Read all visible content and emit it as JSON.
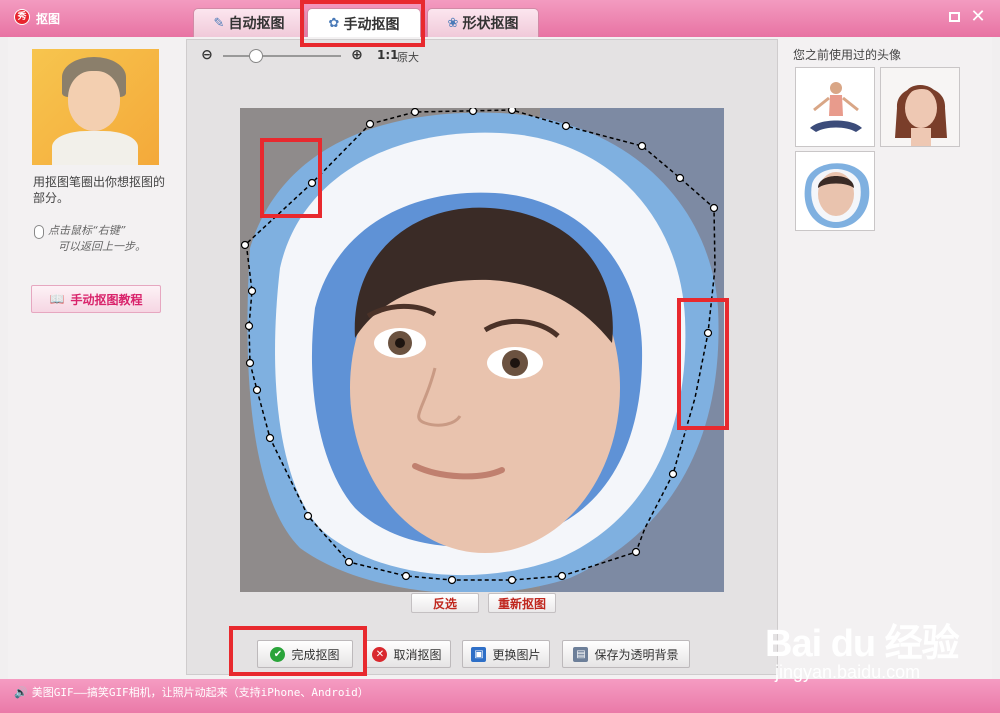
{
  "window": {
    "title": "抠图",
    "app_icon_glyph": "秀"
  },
  "tabs": [
    {
      "label": "自动抠图",
      "icon": "brush-icon",
      "active": false
    },
    {
      "label": "手动抠图",
      "icon": "pen-icon",
      "active": true
    },
    {
      "label": "形状抠图",
      "icon": "shape-icon",
      "active": false
    }
  ],
  "left": {
    "hint": "用抠图笔圈出你想抠图的部分。",
    "mouse_hint_line1": "点击鼠标“右键”",
    "mouse_hint_line2": "可以返回上一步。",
    "tutorial_button": "手动抠图教程"
  },
  "zoom": {
    "ratio": "1:1",
    "original": "原大",
    "level": 0.25
  },
  "canvas_actions": {
    "invert": "反选",
    "redo": "重新抠图"
  },
  "bottom_buttons": {
    "done": "完成抠图",
    "cancel": "取消抠图",
    "change_image": "更换图片",
    "save_transparent": "保存为透明背景"
  },
  "right": {
    "history_title": "您之前使用过的头像"
  },
  "status": {
    "text": "美图GIF——搞笑GIF相机，让照片动起来（支持iPhone、Android）"
  },
  "watermark": {
    "logo": "Bai du 经验",
    "site": "jingyan.baidu.com"
  },
  "colors": {
    "accent_pink": "#e873a3",
    "highlight_red": "#e8292e"
  }
}
